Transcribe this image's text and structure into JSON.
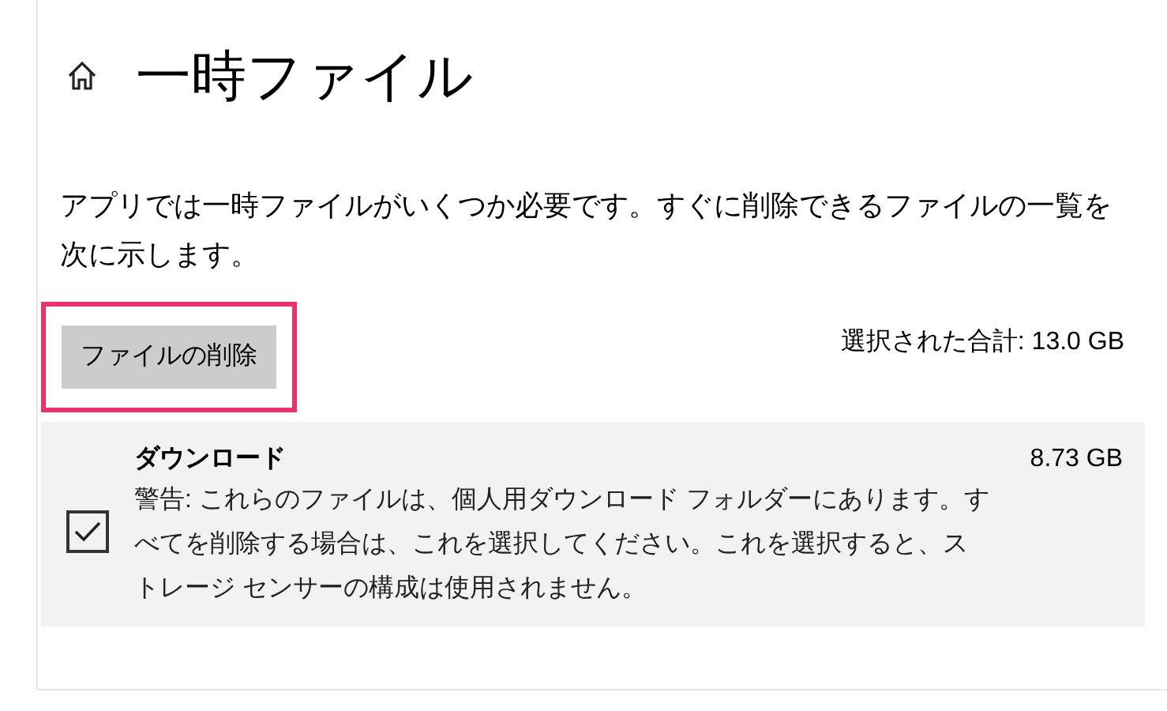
{
  "header": {
    "title": "一時ファイル"
  },
  "description": "アプリでは一時ファイルがいくつか必要です。すぐに削除できるファイルの一覧を次に示します。",
  "delete_button": {
    "label": "ファイルの削除",
    "highlighted": true
  },
  "total": "選択された合計: 13.0 GB",
  "items": [
    {
      "name": "ダウンロード",
      "size": "8.73 GB",
      "checked": true,
      "description": "警告: これらのファイルは、個人用ダウンロード フォルダーにあります。すべてを削除する場合は、これを選択してください。これを選択すると、ストレージ センサーの構成は使用されません。"
    }
  ]
}
